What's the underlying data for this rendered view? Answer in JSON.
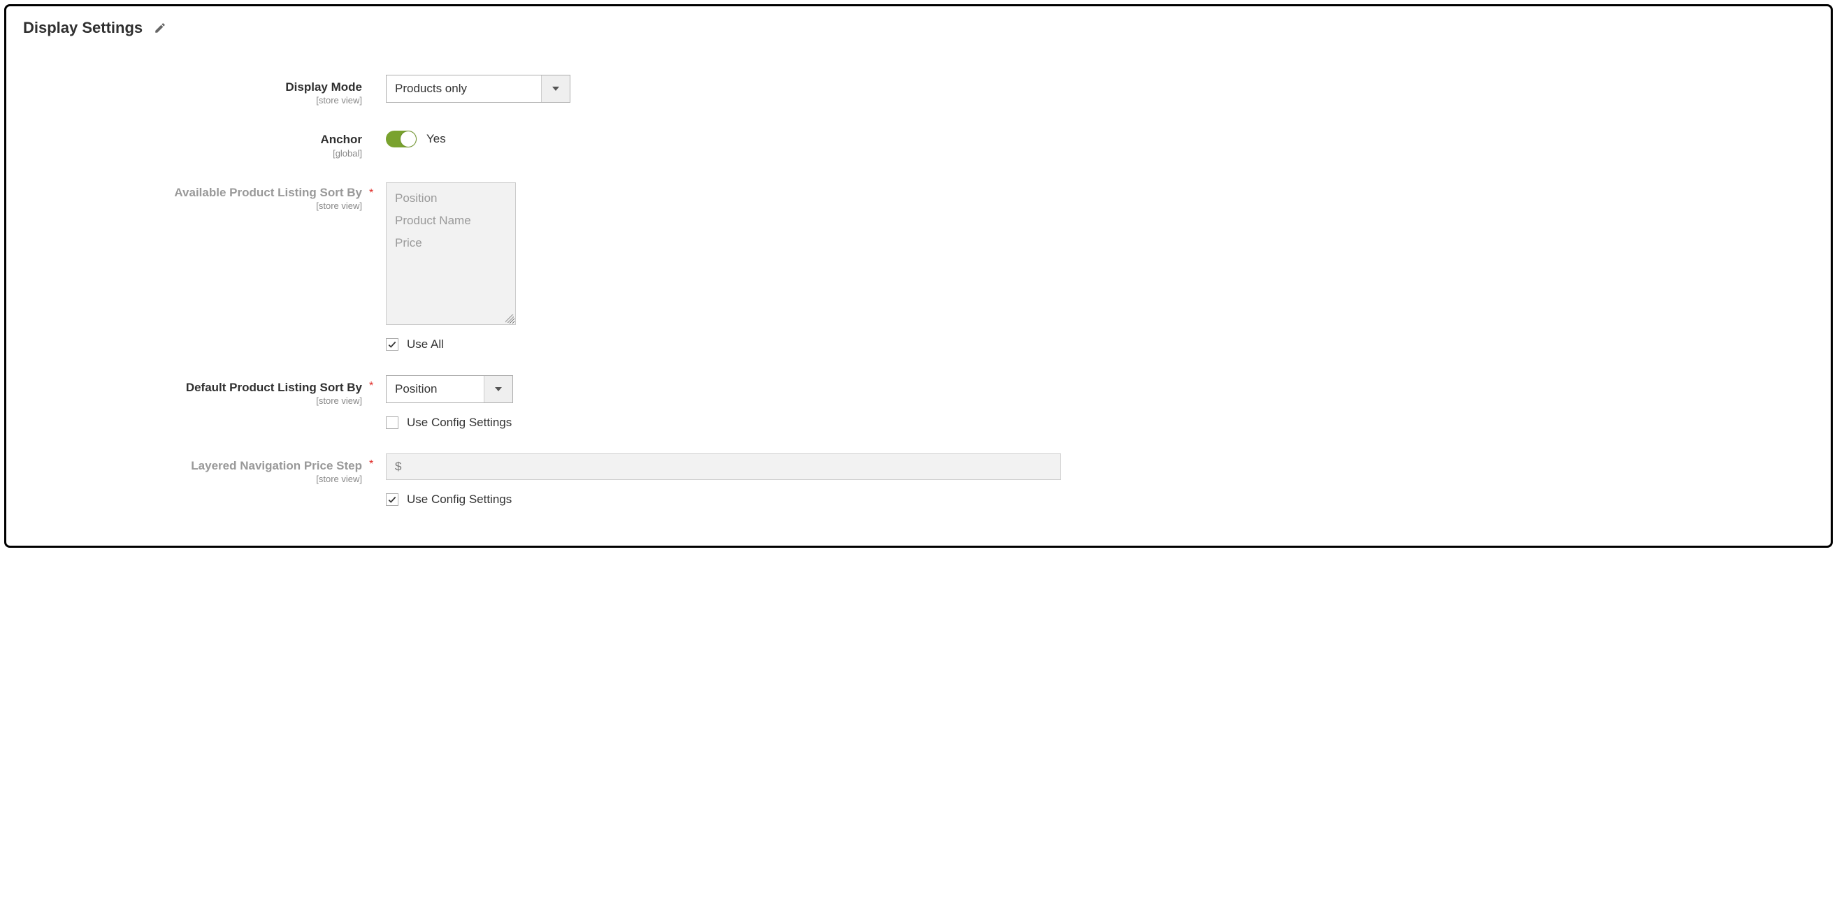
{
  "section": {
    "title": "Display Settings"
  },
  "fields": {
    "display_mode": {
      "label": "Display Mode",
      "scope": "[store view]",
      "value": "Products only"
    },
    "anchor": {
      "label": "Anchor",
      "scope": "[global]",
      "value_text": "Yes"
    },
    "available_sort": {
      "label": "Available Product Listing Sort By",
      "scope": "[store view]",
      "options": {
        "0": "Position",
        "1": "Product Name",
        "2": "Price"
      },
      "use_all_label": "Use All"
    },
    "default_sort": {
      "label": "Default Product Listing Sort By",
      "scope": "[store view]",
      "value": "Position",
      "use_config_label": "Use Config Settings"
    },
    "price_step": {
      "label": "Layered Navigation Price Step",
      "scope": "[store view]",
      "prefix": "$",
      "use_config_label": "Use Config Settings"
    }
  }
}
